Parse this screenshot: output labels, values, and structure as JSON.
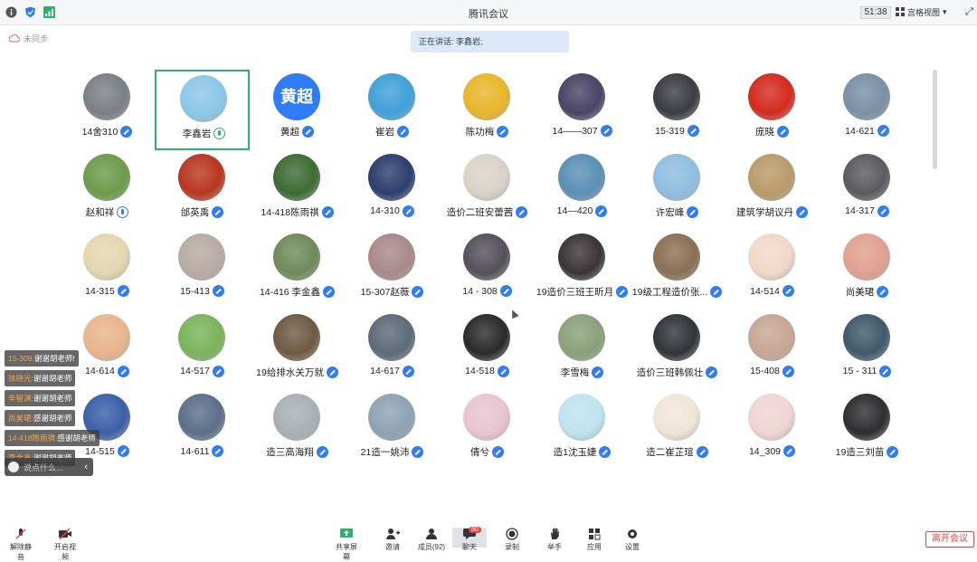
{
  "window": {
    "title": "腾讯会议",
    "timer": "51:38",
    "view_label": "宫格视图"
  },
  "speaking": {
    "text": "正在讲话: 李鑫岩;"
  },
  "cloud": {
    "label": "未同步"
  },
  "colors": {
    "accent": "#2f7cf6",
    "active_border": "#2cb26a",
    "leave": "#e8433e"
  },
  "participants": [
    {
      "name": "14舍310",
      "mic": "muted",
      "avatar": "person-mask"
    },
    {
      "name": "李鑫岩",
      "mic": "speaking",
      "avatar": "cartoon-boy",
      "active": true
    },
    {
      "name": "黄超",
      "mic": "muted",
      "avatar": "text",
      "avatar_text": "黄超"
    },
    {
      "name": "崔岩",
      "mic": "muted",
      "avatar": "woman-blue"
    },
    {
      "name": "陈功梅",
      "mic": "muted",
      "avatar": "sunflower"
    },
    {
      "name": "14——307",
      "mic": "muted",
      "avatar": "anime-dark"
    },
    {
      "name": "15-319",
      "mic": "muted",
      "avatar": "man-portrait"
    },
    {
      "name": "庞晓",
      "mic": "muted",
      "avatar": "red-flower"
    },
    {
      "name": "14-621",
      "mic": "muted",
      "avatar": "sunset"
    },
    {
      "name": "赵和祥",
      "mic": "on",
      "avatar": "man-field"
    },
    {
      "name": "邰英禹",
      "mic": "muted",
      "avatar": "china-poster"
    },
    {
      "name": "14-418陈雨祺",
      "mic": "muted",
      "avatar": "forest"
    },
    {
      "name": "14-310",
      "mic": "muted",
      "avatar": "night-city"
    },
    {
      "name": "造价二班安蕾茜",
      "mic": "muted",
      "avatar": "sketch-face"
    },
    {
      "name": "14—420",
      "mic": "muted",
      "avatar": "totoro"
    },
    {
      "name": "许宏峰",
      "mic": "muted",
      "avatar": "sky-blue"
    },
    {
      "name": "建筑学胡议丹",
      "mic": "muted",
      "avatar": "floral-girl"
    },
    {
      "name": "14-317",
      "mic": "muted",
      "avatar": "man-suit"
    },
    {
      "name": "14-315",
      "mic": "muted",
      "avatar": "dog"
    },
    {
      "name": "15-413",
      "mic": "muted",
      "avatar": "girl-white"
    },
    {
      "name": "14-416 李金鑫",
      "mic": "muted",
      "avatar": "figure-outdoor"
    },
    {
      "name": "15-307赵薇",
      "mic": "muted",
      "avatar": "girl-hand"
    },
    {
      "name": "14 - 308",
      "mic": "muted",
      "avatar": "anime-boy"
    },
    {
      "name": "19造价三班王昕月",
      "mic": "muted",
      "avatar": "couple-dark"
    },
    {
      "name": "19级工程造价张...",
      "mic": "muted",
      "avatar": "room-photo"
    },
    {
      "name": "14-514",
      "mic": "muted",
      "avatar": "cartoon-couple"
    },
    {
      "name": "尚美珺",
      "mic": "muted",
      "avatar": "anime-girl-red"
    },
    {
      "name": "14-614",
      "mic": "muted",
      "avatar": "kitten"
    },
    {
      "name": "14-517",
      "mic": "muted",
      "avatar": "green-character"
    },
    {
      "name": "19给排水关万就",
      "mic": "muted",
      "avatar": "man-sweater"
    },
    {
      "name": "14-617",
      "mic": "muted",
      "avatar": "child-winter"
    },
    {
      "name": "14-518",
      "mic": "muted",
      "avatar": "mask-face"
    },
    {
      "name": "李雪梅",
      "mic": "muted",
      "avatar": "landscape"
    },
    {
      "name": "造价三班韩佩壮",
      "mic": "muted",
      "avatar": "man-dark"
    },
    {
      "name": "15-408",
      "mic": "muted",
      "avatar": "girl-smile"
    },
    {
      "name": "15 - 311",
      "mic": "muted",
      "avatar": "anime-warrior"
    },
    {
      "name": "14-515",
      "mic": "muted",
      "avatar": "cat-blue"
    },
    {
      "name": "14-611",
      "mic": "muted",
      "avatar": "silhouette"
    },
    {
      "name": "造三高海翔",
      "mic": "muted",
      "avatar": "foggy-figure"
    },
    {
      "name": "21造一姚沛",
      "mic": "muted",
      "avatar": "girl-sea"
    },
    {
      "name": "倩兮",
      "mic": "muted",
      "avatar": "anime-pink"
    },
    {
      "name": "造1沈玉婕",
      "mic": "muted",
      "avatar": "anime-cyan"
    },
    {
      "name": "造二崔芷瑄",
      "mic": "muted",
      "avatar": "comic-couple"
    },
    {
      "name": "14_309",
      "mic": "muted",
      "avatar": "cartoon-pair"
    },
    {
      "name": "19造三刘苗",
      "mic": "muted",
      "avatar": "dark-cat"
    }
  ],
  "chat": {
    "messages": [
      {
        "who": "15-309:",
        "text": "谢谢胡老师!"
      },
      {
        "who": "徐晓光:",
        "text": "谢谢胡老师"
      },
      {
        "who": "辛智渊:",
        "text": "谢谢胡老师"
      },
      {
        "who": "尚美珺:",
        "text": "感谢胡老师"
      },
      {
        "who": "14-418陈雨祺:",
        "text": "感谢胡老师"
      },
      {
        "who": "李金鑫:",
        "text": "谢谢胡老师"
      }
    ],
    "input_placeholder": "说点什么..."
  },
  "toolbar": {
    "unmute": "解除静音",
    "video": "开启视频",
    "share": "共享屏幕",
    "invite": "邀请",
    "members": "成员(92)",
    "chat": "聊天",
    "chat_badge": "80",
    "record": "录制",
    "hand": "举手",
    "apps": "应用",
    "settings": "设置",
    "leave": "离开会议"
  }
}
